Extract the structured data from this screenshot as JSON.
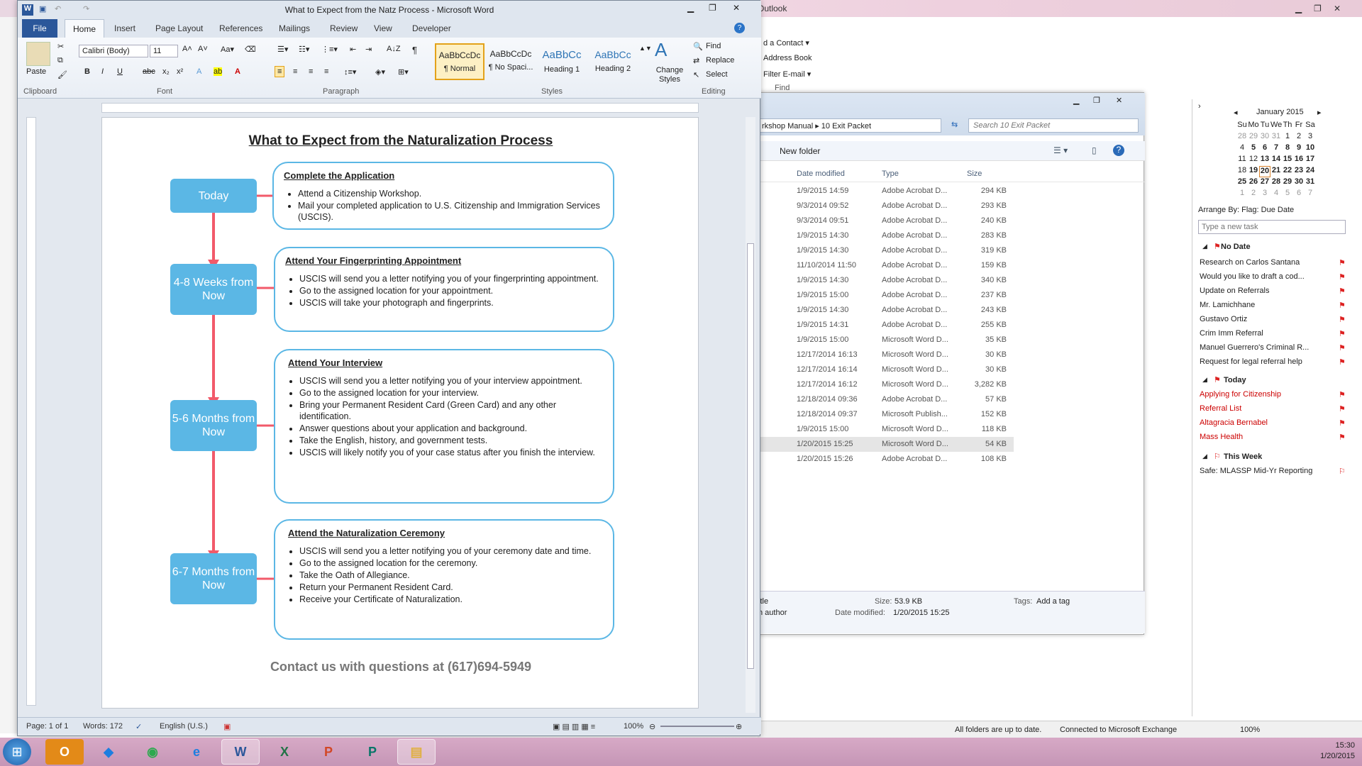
{
  "word": {
    "title": "What to Expect from the Natz Process - Microsoft Word",
    "tabs": {
      "file": "File",
      "home": "Home",
      "insert": "Insert",
      "page_layout": "Page Layout",
      "references": "References",
      "mailings": "Mailings",
      "review": "Review",
      "view": "View",
      "developer": "Developer"
    },
    "ribbon": {
      "font_name": "Calibri (Body)",
      "font_size": "11",
      "paste": "Paste",
      "clipboard": "Clipboard",
      "font": "Font",
      "paragraph": "Paragraph",
      "styles": "Styles",
      "editing": "Editing",
      "change_styles": "Change Styles",
      "find": "Find",
      "replace": "Replace",
      "select": "Select",
      "style_sample": "AaBbCcDc",
      "style_sample2": "AaBbCcDc",
      "style_sample3": "AaBbCc",
      "style_sample4": "AaBbCc",
      "style_names": [
        "¶ Normal",
        "¶ No Spaci...",
        "Heading 1",
        "Heading 2"
      ]
    },
    "status": {
      "page": "Page: 1 of 1",
      "words": "Words: 172",
      "language": "English (U.S.)",
      "zoom": "100%"
    }
  },
  "doc": {
    "title": "What to Expect from the Naturalization Process",
    "steps": [
      {
        "label": "Today",
        "heading": "Complete the Application",
        "items": [
          "Attend a Citizenship Workshop.",
          "Mail your completed application to U.S. Citizenship and Immigration Services (USCIS)."
        ]
      },
      {
        "label": "4-8 Weeks from Now",
        "heading": "Attend Your Fingerprinting Appointment",
        "items": [
          "USCIS will send you a letter notifying you of your fingerprinting appointment.",
          "Go to the assigned location for your appointment.",
          "USCIS will take your photograph and fingerprints."
        ]
      },
      {
        "label": "5-6 Months from Now",
        "heading": "Attend Your Interview",
        "items": [
          "USCIS will send you a letter notifying you of your interview appointment.",
          "Go to the assigned location for your interview.",
          "Bring your Permanent Resident Card (Green Card) and any other identification.",
          "Answer questions about your application and background.",
          "Take the English, history, and government tests.",
          "USCIS will likely notify you of your case status after you finish the interview."
        ]
      },
      {
        "label": "6-7 Months from Now",
        "heading": "Attend the Naturalization Ceremony",
        "items": [
          "USCIS will send you a letter notifying you of your ceremony date and time.",
          "Go to the assigned location for the ceremony.",
          "Take the Oath of Allegiance.",
          "Return your Permanent Resident Card.",
          "Receive your Certificate of Naturalization."
        ]
      }
    ],
    "contact": "Contact us with questions at (617)694-5949"
  },
  "outlook": {
    "title": "Outlook",
    "ribbon": [
      "d a Contact ▾",
      "Address Book",
      "Filter E-mail ▾",
      "Find"
    ],
    "status": {
      "sync": "All folders are up to date.",
      "exchange": "Connected to Microsoft Exchange",
      "zoom": "100%"
    },
    "calendar": {
      "month": "January 2015",
      "days": [
        "Su",
        "Mo",
        "Tu",
        "We",
        "Th",
        "Fr",
        "Sa"
      ],
      "weeks": [
        [
          "28",
          "29",
          "30",
          "31",
          "1",
          "2",
          "3"
        ],
        [
          "4",
          "5",
          "6",
          "7",
          "8",
          "9",
          "10"
        ],
        [
          "11",
          "12",
          "13",
          "14",
          "15",
          "16",
          "17"
        ],
        [
          "18",
          "19",
          "20",
          "21",
          "22",
          "23",
          "24"
        ],
        [
          "25",
          "26",
          "27",
          "28",
          "29",
          "30",
          "31"
        ],
        [
          "1",
          "2",
          "3",
          "4",
          "5",
          "6",
          "7"
        ]
      ]
    },
    "arrange": "Arrange By: Flag: Due Date",
    "new_task": "Type a new task",
    "groups": {
      "no_date": "No Date",
      "today": "Today",
      "this_week": "This Week"
    },
    "no_date_tasks": [
      "Research on Carlos Santana",
      "Would you like to draft a cod...",
      "Update on Referrals",
      "Mr. Lamichhane",
      "Gustavo Ortiz",
      "Crim Imm Referral",
      "Manuel Guerrero's Criminal R...",
      "Request for legal referral help"
    ],
    "today_tasks": [
      "Applying for Citizenship",
      "Referral List",
      "Altagracia Bernabel",
      "Mass Health"
    ],
    "week_tasks": [
      "Safe: MLASSP Mid-Yr Reporting"
    ]
  },
  "explorer": {
    "path": "rkshop Manual ▸ 10 Exit Packet",
    "search": "Search 10 Exit Packet",
    "new_folder": "New folder",
    "columns": [
      "Date modified",
      "Type",
      "Size"
    ],
    "rows": [
      [
        "1/9/2015 14:59",
        "Adobe Acrobat D...",
        "294 KB"
      ],
      [
        "9/3/2014 09:52",
        "Adobe Acrobat D...",
        "293 KB"
      ],
      [
        "9/3/2014 09:51",
        "Adobe Acrobat D...",
        "240 KB"
      ],
      [
        "1/9/2015 14:30",
        "Adobe Acrobat D...",
        "283 KB"
      ],
      [
        "1/9/2015 14:30",
        "Adobe Acrobat D...",
        "319 KB"
      ],
      [
        "11/10/2014 11:50",
        "Adobe Acrobat D...",
        "159 KB"
      ],
      [
        "1/9/2015 14:30",
        "Adobe Acrobat D...",
        "340 KB"
      ],
      [
        "1/9/2015 15:00",
        "Adobe Acrobat D...",
        "237 KB"
      ],
      [
        "1/9/2015 14:30",
        "Adobe Acrobat D...",
        "243 KB"
      ],
      [
        "1/9/2015 14:31",
        "Adobe Acrobat D...",
        "255 KB"
      ],
      [
        "1/9/2015 15:00",
        "Microsoft Word D...",
        "35 KB"
      ],
      [
        "12/17/2014 16:13",
        "Microsoft Word D...",
        "30 KB"
      ],
      [
        "12/17/2014 16:14",
        "Microsoft Word D...",
        "30 KB"
      ],
      [
        "12/17/2014 16:12",
        "Microsoft Word D...",
        "3,282 KB"
      ],
      [
        "12/18/2014 09:36",
        "Adobe Acrobat D...",
        "57 KB"
      ],
      [
        "12/18/2014 09:37",
        "Microsoft Publish...",
        "152 KB"
      ],
      [
        "1/9/2015 15:00",
        "Microsoft Word D...",
        "118 KB"
      ],
      [
        "1/20/2015 15:25",
        "Microsoft Word D...",
        "54 KB"
      ],
      [
        "1/20/2015 15:26",
        "Adobe Acrobat D...",
        "108 KB"
      ]
    ],
    "details": {
      "title": "itle",
      "author": "n author",
      "size_label": "Size:",
      "size": "53.9 KB",
      "tags_label": "Tags:",
      "tags": "Add a tag",
      "modified_label": "Date modified:",
      "modified": "1/20/2015 15:25"
    }
  },
  "taskbar": {
    "time": "15:30",
    "date": "1/20/2015"
  }
}
